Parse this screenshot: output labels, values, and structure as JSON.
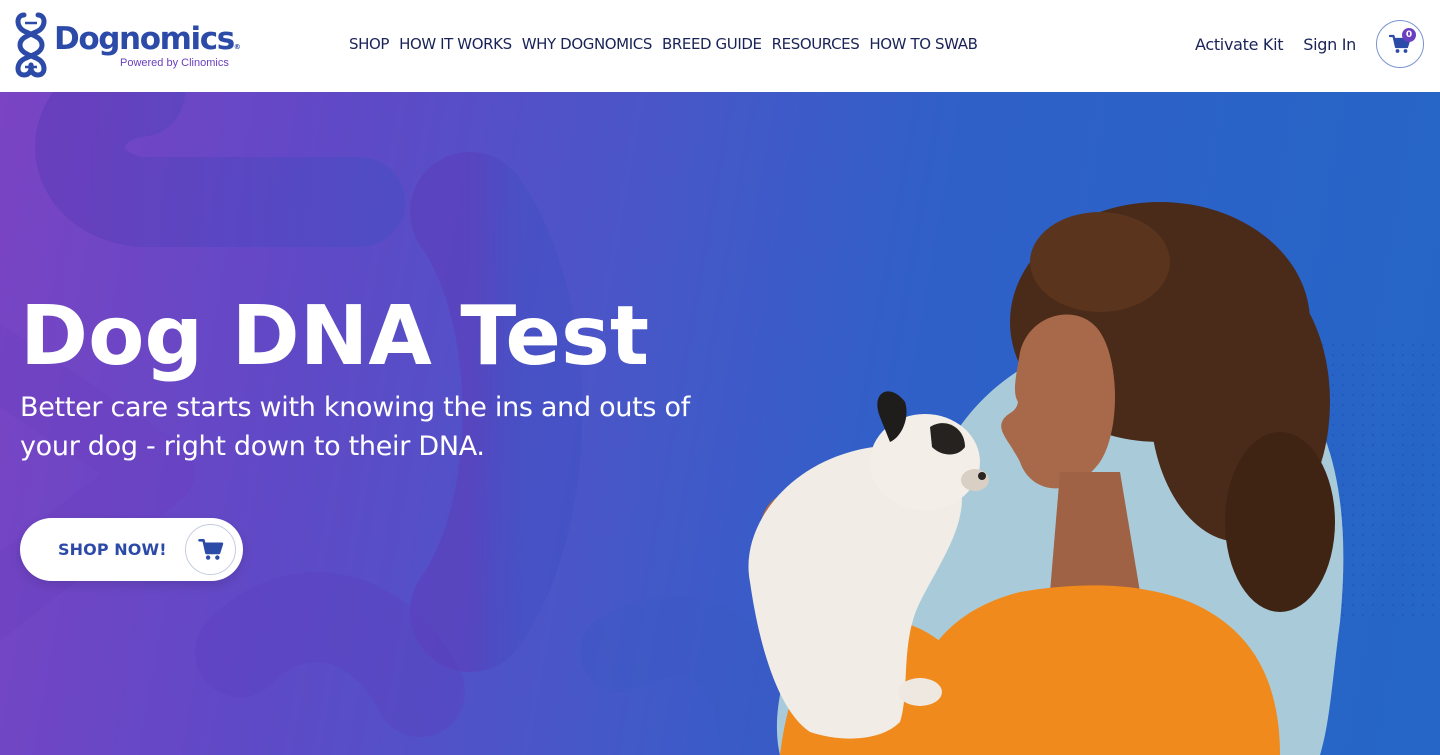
{
  "brand": {
    "name": "Dognomics",
    "registered_mark": "®",
    "tagline": "Powered by Clinomics",
    "colors": {
      "primary": "#2c4aa8",
      "accent": "#6a3fc0"
    }
  },
  "nav": {
    "items": [
      {
        "label": "SHOP"
      },
      {
        "label": "HOW IT WORKS"
      },
      {
        "label": "WHY DOGNOMICS"
      },
      {
        "label": "BREED GUIDE"
      },
      {
        "label": "RESOURCES"
      },
      {
        "label": "HOW TO SWAB"
      }
    ]
  },
  "header": {
    "activate_label": "Activate Kit",
    "signin_label": "Sign In",
    "cart_icon": "shopping-cart-icon",
    "cart_count": "0"
  },
  "hero": {
    "title": "Dog DNA Test",
    "subtitle": "Better care starts with knowing the ins and outs of your dog - right down to their DNA.",
    "cta_label": "SHOP NOW!",
    "cta_icon": "shopping-cart-icon",
    "photo": "woman-kissing-french-bulldog-puppy",
    "colors": {
      "gradient_start": "#7a44c4",
      "gradient_end": "#2566c6",
      "cta_text": "#2c4aa8"
    }
  }
}
